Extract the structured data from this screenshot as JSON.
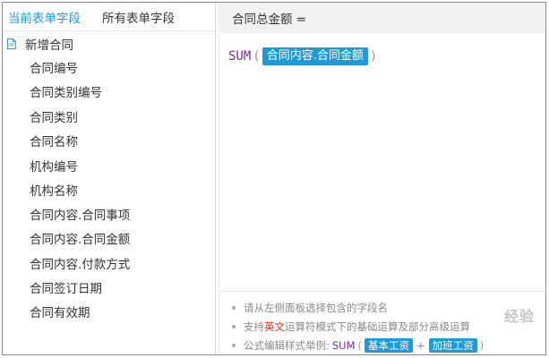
{
  "tabs": {
    "current": "当前表单字段",
    "all": "所有表单字段"
  },
  "tree": {
    "root_label": "新增合同",
    "fields": [
      "合同编号",
      "合同类别编号",
      "合同类别",
      "合同名称",
      "机构编号",
      "机构名称",
      "合同内容.合同事项",
      "合同内容.合同金额",
      "合同内容.付款方式",
      "合同签订日期",
      "合同有效期"
    ]
  },
  "formula": {
    "target": "合同总金额 =",
    "function": "SUM",
    "open_paren": "(",
    "close_paren": ")",
    "argument": "合同内容.合同金额"
  },
  "hints": {
    "line1": "请从左侧面板选择包含的字段名",
    "line2_prefix": "支持",
    "line2_highlight": "英文",
    "line2_suffix": "运算符模式下的基础运算及部分高级运算",
    "line3_prefix": "公式编辑样式举例:",
    "line3_fn": "SUM",
    "line3_open": "(",
    "line3_token1": "基本工资",
    "line3_op": "+",
    "line3_token2": "加班工资",
    "line3_close": ")"
  },
  "colors": {
    "accent": "#1e9ad6",
    "function": "#7b2b8b",
    "highlight": "#e0301e"
  },
  "watermark": "经验"
}
